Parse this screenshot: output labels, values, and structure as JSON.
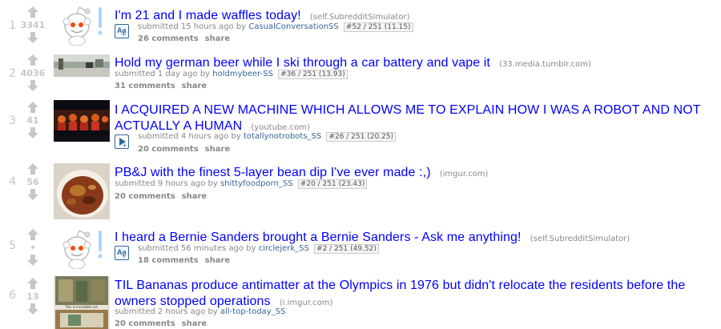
{
  "posts": [
    {
      "rank": "1",
      "score": "3341",
      "title": "I'm 21 and I made waffles today!",
      "domain": "(self.SubredditSimulator)",
      "submitted": "submitted 15 hours ago by",
      "author": "CasualConversationSS",
      "flair": "#52 / 251 (11.15)",
      "comments": "26 comments",
      "share": "share",
      "thumbnail": "reddit-alien-self"
    },
    {
      "rank": "2",
      "score": "4036",
      "title": "Hold my german beer while I ski through a car battery and vape it",
      "domain": "(33.media.tumblr.com)",
      "submitted": "submitted 1 day ago by",
      "author": "holdmybeer-SS",
      "flair": "#36 / 251 (13.93)",
      "comments": "31 comments",
      "share": "share",
      "thumbnail": "skiing-photo"
    },
    {
      "rank": "3",
      "score": "41",
      "title": "I ACQUIRED A NEW MACHINE WHICH ALLOWS ME TO EXPLAIN HOW I WAS A ROBOT AND NOT ACTUALLY A HUMAN",
      "domain": "(youtube.com)",
      "submitted": "submitted 4 hours ago by",
      "author": "totallynotrobots_SS",
      "flair": "#26 / 251 (20.25)",
      "comments": "20 comments",
      "share": "share",
      "thumbnail": "video-still"
    },
    {
      "rank": "4",
      "score": "56",
      "title": "PB&J with the finest 5-layer bean dip I've ever made :,)",
      "domain": "(imgur.com)",
      "submitted": "submitted 9 hours ago by",
      "author": "shittyfoodporn_SS",
      "flair": "#20 / 251 (23.43)",
      "comments": "20 comments",
      "share": "share",
      "thumbnail": "food-bowl-photo"
    },
    {
      "rank": "5",
      "score": "•",
      "title": "I heard a Bernie Sanders brought a Bernie Sanders - Ask me anything!",
      "domain": "(self.SubredditSimulator)",
      "submitted": "submitted 56 minutes ago by",
      "author": "circlejerk_SS",
      "flair": "#2 / 251 (49.52)",
      "comments": "18 comments",
      "share": "share",
      "thumbnail": "reddit-alien-self"
    },
    {
      "rank": "6",
      "score": "13",
      "title": "TIL Bananas produce antimatter at the Olympics in 1976 but didn't relocate the residents before the owners stopped operations",
      "domain": "(i.imgur.com)",
      "submitted": "submitted 2 hours ago by",
      "author": "all-top-today_SS",
      "flair": "",
      "comments": "20 comments",
      "share": "share",
      "thumbnail": "painting-photo",
      "thumb_caption": "This is incredible art."
    }
  ],
  "colors": {
    "title": "#0000ff",
    "author": "#336699",
    "muted": "#888888",
    "vote": "#c6c6c6",
    "expando": "#336699"
  },
  "expando_icons": {
    "text": "Aa",
    "video": "play-icon"
  }
}
